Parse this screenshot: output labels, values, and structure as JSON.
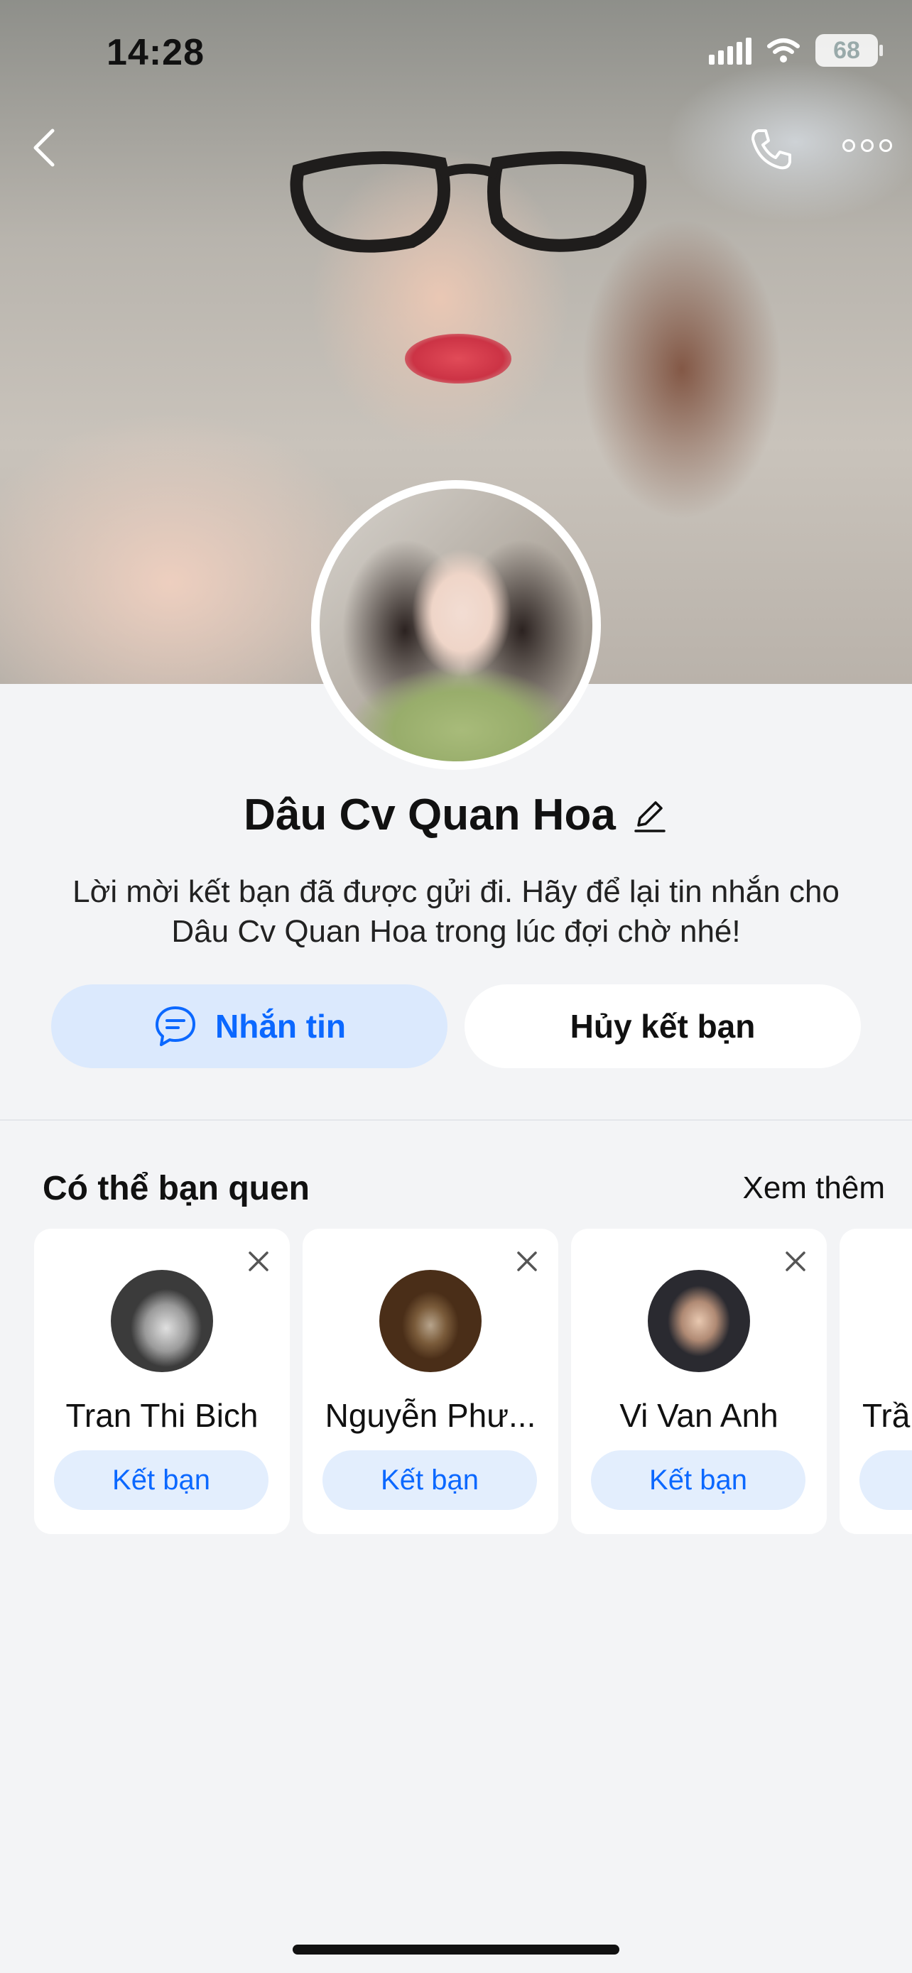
{
  "status_bar": {
    "time": "14:28",
    "battery": "68"
  },
  "profile": {
    "name": "Dâu Cv Quan Hoa",
    "message": "Lời mời kết bạn đã được gửi đi. Hãy để lại tin nhắn cho Dâu Cv Quan Hoa trong lúc đợi chờ nhé!",
    "message_button": "Nhắn tin",
    "cancel_button": "Hủy kết bạn"
  },
  "suggestions": {
    "title": "Có thể bạn quen",
    "see_more": "Xem thêm",
    "items": [
      {
        "name": "Tran Thi Bich",
        "action": "Kết bạn"
      },
      {
        "name": "Nguyễn Phư...",
        "action": "Kết bạn"
      },
      {
        "name": "Vi Van Anh",
        "action": "Kết bạn"
      },
      {
        "name": "Trầ",
        "action": ""
      }
    ]
  },
  "colors": {
    "accent": "#0b68ff",
    "accent_bg": "#dbe9fd",
    "page_bg": "#f3f4f6"
  },
  "icons": [
    "back-icon",
    "phone-icon",
    "more-icon",
    "edit-icon",
    "chat-icon",
    "close-icon"
  ]
}
